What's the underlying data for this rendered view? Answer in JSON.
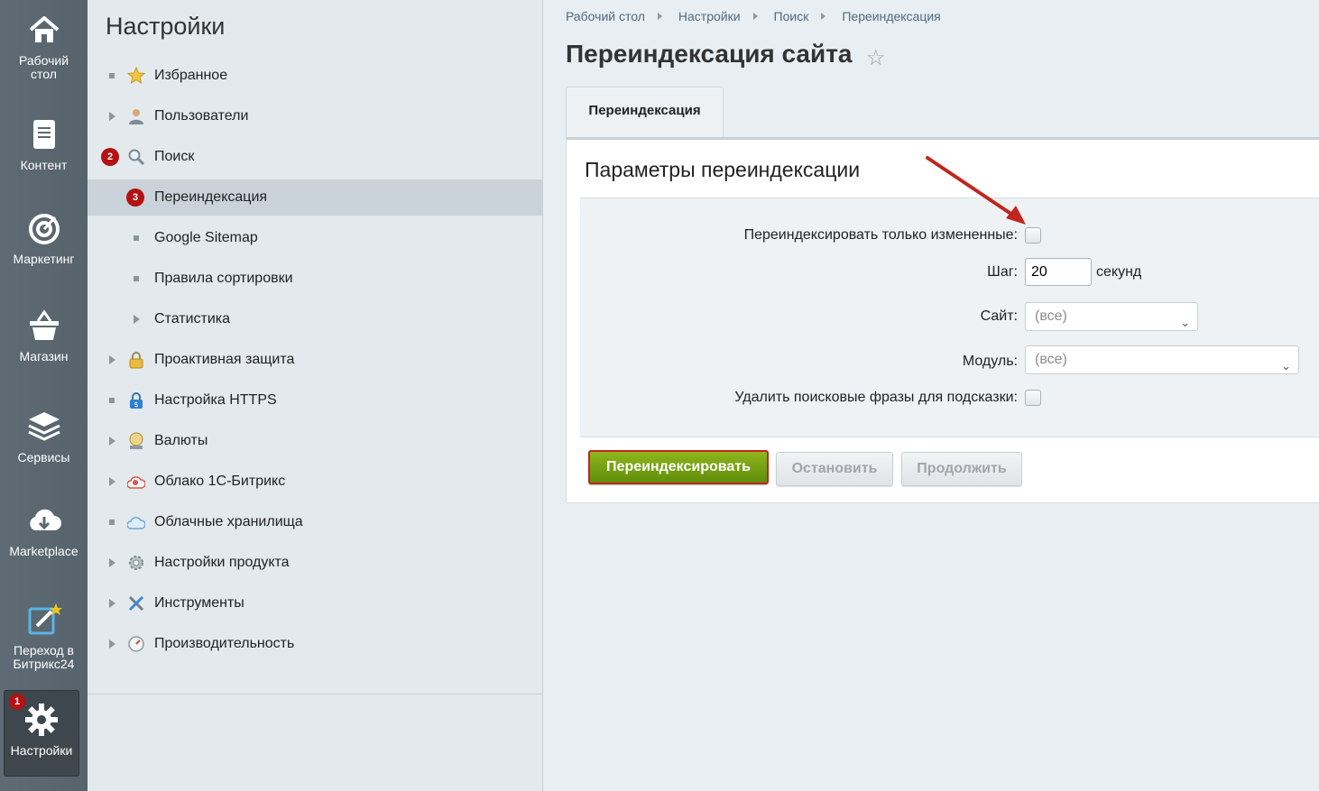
{
  "rail": {
    "items": [
      {
        "label_line1": "Рабочий",
        "label_line2": "стол",
        "icon": "home-icon"
      },
      {
        "label_line1": "Контент",
        "label_line2": "",
        "icon": "document-icon"
      },
      {
        "label_line1": "Маркетинг",
        "label_line2": "",
        "icon": "target-icon"
      },
      {
        "label_line1": "Магазин",
        "label_line2": "",
        "icon": "basket-icon"
      },
      {
        "label_line1": "Сервисы",
        "label_line2": "",
        "icon": "layers-icon"
      },
      {
        "label_line1": "Marketplace",
        "label_line2": "",
        "icon": "cloud-download-icon"
      },
      {
        "label_line1": "Переход в",
        "label_line2": "Битрикс24",
        "icon": "edit-star-icon"
      },
      {
        "label_line1": "Настройки",
        "label_line2": "",
        "icon": "gear-icon",
        "badge": "1"
      }
    ]
  },
  "menu": {
    "title": "Настройки",
    "items": [
      {
        "label": "Избранное",
        "icon": "star-icon"
      },
      {
        "label": "Пользователи",
        "icon": "user-icon"
      },
      {
        "label": "Поиск",
        "icon": "magnifier-icon",
        "badge": "2"
      },
      {
        "label": "Переиндексация",
        "badge": "3"
      },
      {
        "label": "Google Sitemap"
      },
      {
        "label": "Правила сортировки"
      },
      {
        "label": "Статистика"
      },
      {
        "label": "Проактивная защита",
        "icon": "lock-icon"
      },
      {
        "label": "Настройка HTTPS",
        "icon": "https-lock-icon"
      },
      {
        "label": "Валюты",
        "icon": "coin-icon"
      },
      {
        "label": "Облако 1С-Битрикс",
        "icon": "cloud-bitrix-icon"
      },
      {
        "label": "Облачные хранилища",
        "icon": "cloud-storage-icon"
      },
      {
        "label": "Настройки продукта",
        "icon": "cog-icon"
      },
      {
        "label": "Инструменты",
        "icon": "tools-icon"
      },
      {
        "label": "Производительность",
        "icon": "gauge-icon"
      }
    ]
  },
  "breadcrumb": [
    "Рабочий стол",
    "Настройки",
    "Поиск",
    "Переиндексация"
  ],
  "page": {
    "title": "Переиндексация сайта",
    "tab": "Переиндексация",
    "panel_title": "Параметры переиндексации"
  },
  "form": {
    "only_changed_label": "Переиндексировать только измененные:",
    "only_changed_checked": false,
    "step_label": "Шаг:",
    "step_value": "20",
    "step_unit": "секунд",
    "site_label": "Сайт:",
    "site_value": "(все)",
    "module_label": "Модуль:",
    "module_value": "(все)",
    "delete_phrases_label": "Удалить поисковые фразы для подсказки:",
    "delete_phrases_checked": false
  },
  "buttons": {
    "reindex": "Переиндексировать",
    "stop": "Остановить",
    "continue": "Продолжить"
  },
  "colors": {
    "accent_green": "#6f9a12",
    "badge_red": "#b31212",
    "annotation_red": "#c0261e"
  }
}
